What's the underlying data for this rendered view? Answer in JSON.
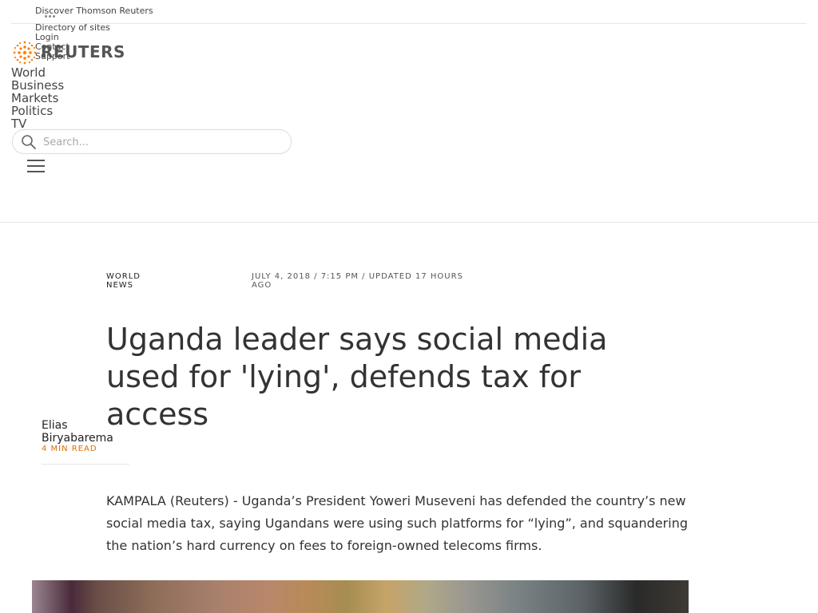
{
  "utility_bar": {
    "discover": "Discover Thomson Reuters",
    "links": [
      "Directory of sites",
      "Login",
      "Contact",
      "Support"
    ]
  },
  "brand": {
    "name": "REUTERS",
    "accent": "#ff8000"
  },
  "nav": {
    "items": [
      "World",
      "Business",
      "Markets",
      "Politics",
      "TV"
    ]
  },
  "search": {
    "placeholder": "Search..."
  },
  "article": {
    "section": "WORLD NEWS",
    "dateline": "JULY 4, 2018 / 7:15 PM / UPDATED 17 HOURS AGO",
    "headline": "Uganda leader says social media used for 'lying', defends tax for access",
    "author": "Elias Biryabarema",
    "read_time": "4 MIN READ",
    "lead": "KAMPALA (Reuters) - Uganda’s President Yoweri Museveni has defended the country’s new social media tax, saying Ugandans were using such platforms for “lying”, and squandering the nation’s hard currency on fees to foreign-owned telecoms firms."
  },
  "colors": {
    "read_time": "#dc6f00",
    "text": "#333333"
  }
}
